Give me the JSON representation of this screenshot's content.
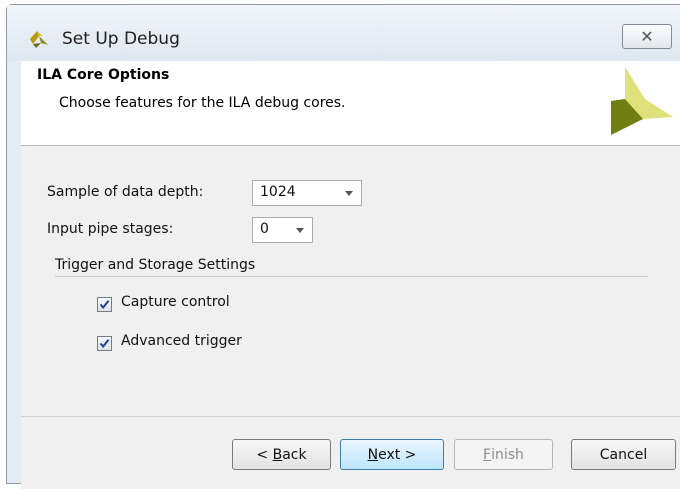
{
  "window": {
    "title": "Set Up Debug",
    "close_glyph": "✕"
  },
  "header": {
    "title": "ILA Core Options",
    "subtitle": "Choose features for the ILA debug cores."
  },
  "options": {
    "sample_depth": {
      "label": "Sample of data depth:",
      "value": "1024"
    },
    "pipe_stages": {
      "label": "Input pipe stages:",
      "value": "0"
    },
    "group_title": "Trigger and Storage Settings",
    "capture_control": {
      "label": "Capture control",
      "checked": true
    },
    "advanced_trigger": {
      "label": "Advanced trigger",
      "checked": true
    }
  },
  "buttons": {
    "back": {
      "prefix": "< ",
      "mnemonic": "B",
      "rest": "ack"
    },
    "next": {
      "mnemonic": "N",
      "rest": "ext >"
    },
    "finish": {
      "mnemonic": "F",
      "rest": "inish"
    },
    "cancel": "Cancel"
  },
  "colors": {
    "logo_light": "#dfe27a",
    "logo_dark": "#6f7f12",
    "check": "#1f3f8c"
  }
}
